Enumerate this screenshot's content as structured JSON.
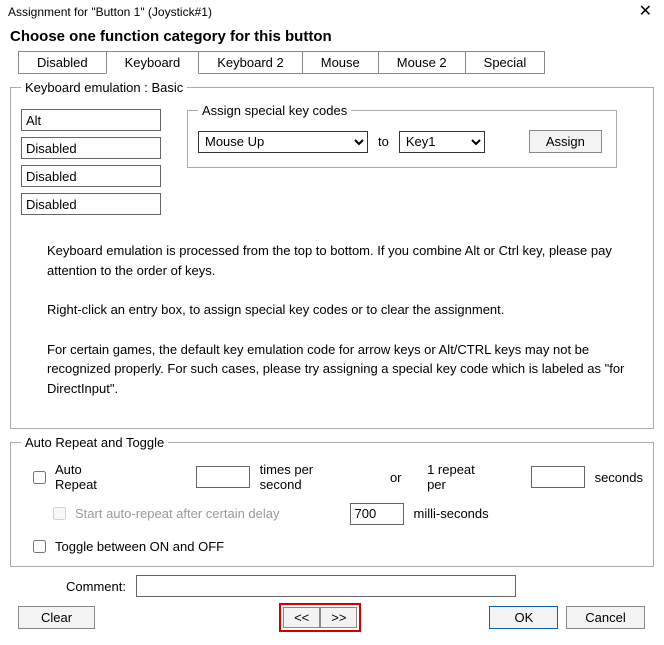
{
  "window": {
    "title": "Assignment for \"Button 1\" (Joystick#1)"
  },
  "heading": "Choose one function category for this button",
  "tabs": {
    "disabled": "Disabled",
    "keyboard": "Keyboard",
    "keyboard2": "Keyboard 2",
    "mouse": "Mouse",
    "mouse2": "Mouse 2",
    "special": "Special"
  },
  "kb_group": {
    "legend": "Keyboard emulation : Basic",
    "keys": {
      "k1": "Alt",
      "k2": "Disabled",
      "k3": "Disabled",
      "k4": "Disabled"
    },
    "special": {
      "legend": "Assign special key codes",
      "code": "Mouse Up",
      "to": "to",
      "slot": "Key1",
      "assign": "Assign"
    },
    "desc1": "Keyboard emulation is processed from the top to bottom.  If you combine Alt or Ctrl key, please pay attention to the order of keys.",
    "desc2": "Right-click an entry box, to assign special key codes or to clear the assignment.",
    "desc3": "For certain games, the default key emulation code for arrow keys or Alt/CTRL keys may not be recognized properly.  For such cases, please try assigning a special key code which is labeled as \"for DirectInput\"."
  },
  "repeat": {
    "legend": "Auto Repeat and Toggle",
    "auto_repeat": "Auto Repeat",
    "tps_value": "",
    "tps_label": "times per second",
    "or": "or",
    "one_repeat": "1 repeat per",
    "sec_value": "",
    "seconds": "seconds",
    "delay_label": "Start auto-repeat after certain delay",
    "delay_value": "700",
    "ms": "milli-seconds",
    "toggle": "Toggle between ON and OFF"
  },
  "comment": {
    "label": "Comment:",
    "value": ""
  },
  "buttons": {
    "clear": "Clear",
    "prev": "<<",
    "next": ">>",
    "ok": "OK",
    "cancel": "Cancel"
  }
}
